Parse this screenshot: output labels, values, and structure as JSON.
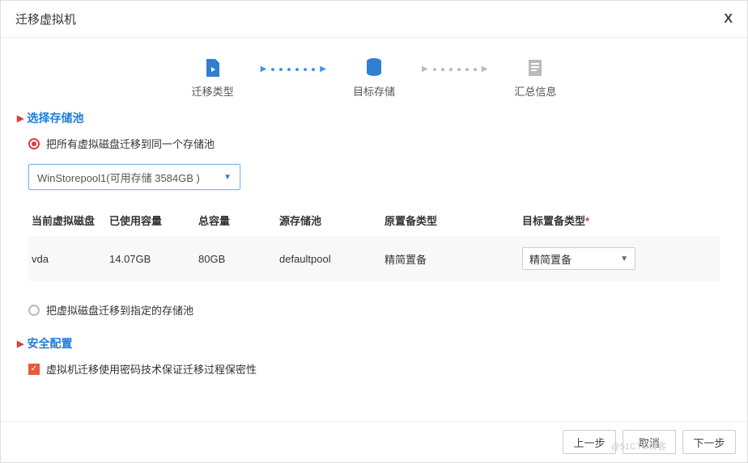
{
  "dialog": {
    "title": "迁移虚拟机",
    "close": "X"
  },
  "steps": {
    "s1": "迁移类型",
    "s2": "目标存储",
    "s3": "汇总信息"
  },
  "sections": {
    "pool_title": "选择存储池",
    "radio_same_pool": "把所有虚拟磁盘迁移到同一个存储池",
    "pool_select": "WinStorepool1(可用存储 3584GB )",
    "radio_each_pool": "把虚拟磁盘迁移到指定的存储池",
    "security_title": "安全配置",
    "security_check": "虚拟机迁移使用密码技术保证迁移过程保密性"
  },
  "table": {
    "headers": {
      "disk": "当前虚拟磁盘",
      "used": "已使用容量",
      "total": "总容量",
      "src": "源存储池",
      "orig_type": "原置备类型",
      "target_type": "目标置备类型"
    },
    "rows": [
      {
        "disk": "vda",
        "used": "14.07GB",
        "total": "80GB",
        "src": "defaultpool",
        "orig_type": "精简置备",
        "target_type": "精简置备"
      }
    ]
  },
  "footer": {
    "prev": "上一步",
    "cancel": "取消",
    "next": "下一步"
  },
  "watermark": "@51CTO博客"
}
